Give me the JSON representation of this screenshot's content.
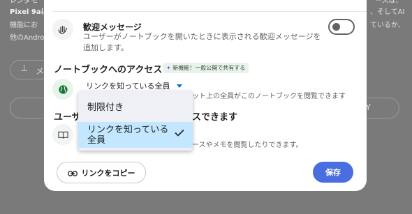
{
  "background": {
    "line1_left": "レンダモ",
    "line1_right": "ースは、",
    "line2_left": "Pixel 9aに",
    "line2_right": "、そしてAI",
    "line3_left": "機能にお",
    "line3_right": "ているか、",
    "line4_left": "他のAndro",
    "chip_label": "メ",
    "bar_right": "Y"
  },
  "welcome": {
    "title": "歓迎メッセージ",
    "description": "ユーザーがノートブックを開いたときに表示される歓迎メッセージを追加します。",
    "toggle_on": false
  },
  "access": {
    "heading": "ノートブックへのアクセス",
    "badge": "新機能！一般公開で共有する",
    "selected": "リンクを知っている全員",
    "description": "ット上の全員がこのノートブックを閲覧できます"
  },
  "dropdown": {
    "options": [
      "制限付き",
      "リンクを知っている全員"
    ],
    "selected_index": 1
  },
  "users": {
    "heading_left": "ユーザ",
    "heading_right": "スできます",
    "description": "ースやメモを閲覧したりできます。"
  },
  "footer": {
    "copy_label": "リンクをコピー",
    "save_label": "保存"
  },
  "colors": {
    "primary": "#4a6ee0",
    "selected_option": "#c2e7ff",
    "badge_bg": "#e6f4ea"
  }
}
